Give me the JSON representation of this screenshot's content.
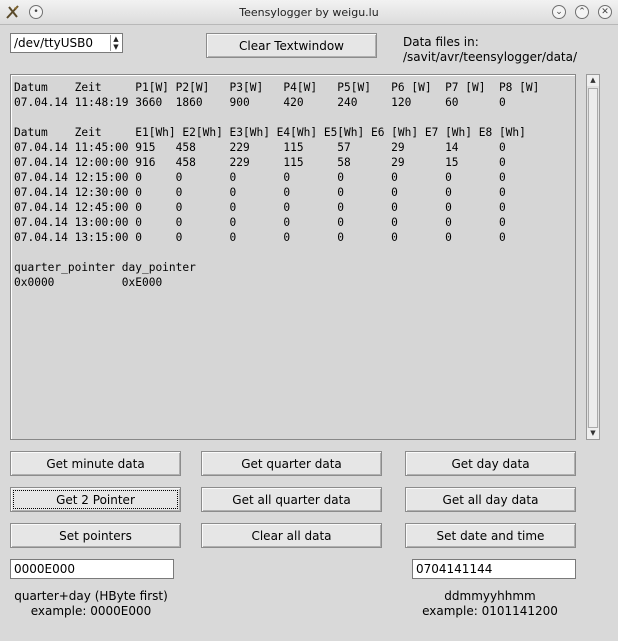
{
  "window": {
    "title": "Teensylogger by weigu.lu"
  },
  "serial": {
    "port": "/dev/ttyUSB0"
  },
  "toolbar": {
    "clear_label": "Clear Textwindow"
  },
  "data_files": {
    "line1": "Data files in:",
    "line2": "/savit/avr/teensylogger/data/"
  },
  "textwindow": {
    "lines": [
      "Datum    Zeit     P1[W] P2[W]   P3[W]   P4[W]   P5[W]   P6 [W]  P7 [W]  P8 [W]",
      "07.04.14 11:48:19 3660  1860    900     420     240     120     60      0",
      "",
      "Datum    Zeit     E1[Wh] E2[Wh] E3[Wh] E4[Wh] E5[Wh] E6 [Wh] E7 [Wh] E8 [Wh]",
      "07.04.14 11:45:00 915   458     229     115     57      29      14      0",
      "07.04.14 12:00:00 916   458     229     115     58      29      15      0",
      "07.04.14 12:15:00 0     0       0       0       0       0       0       0",
      "07.04.14 12:30:00 0     0       0       0       0       0       0       0",
      "07.04.14 12:45:00 0     0       0       0       0       0       0       0",
      "07.04.14 13:00:00 0     0       0       0       0       0       0       0",
      "07.04.14 13:15:00 0     0       0       0       0       0       0       0",
      "",
      "quarter_pointer day_pointer",
      "0x0000          0xE000"
    ]
  },
  "buttons": {
    "minute": "Get minute data",
    "quarter": "Get quarter data",
    "day": "Get day data",
    "two_pointer": "Get 2 Pointer",
    "all_quarter": "Get all quarter data",
    "all_day": "Get all day data",
    "set_pointers": "Set pointers",
    "clear_all": "Clear all data",
    "set_date": "Set date and time"
  },
  "pointer_entry": {
    "value": "0000E000",
    "caption1": "quarter+day (HByte first)",
    "caption2": "example: 0000E000"
  },
  "date_entry": {
    "value": "0704141144",
    "caption1": "ddmmyyhhmm",
    "caption2": "example: 0101141200"
  },
  "icons": {
    "app": "tk-feather-icon",
    "menu": "window-menu-icon",
    "minimize": "minimize-icon",
    "maximize": "maximize-icon",
    "close": "close-icon"
  }
}
